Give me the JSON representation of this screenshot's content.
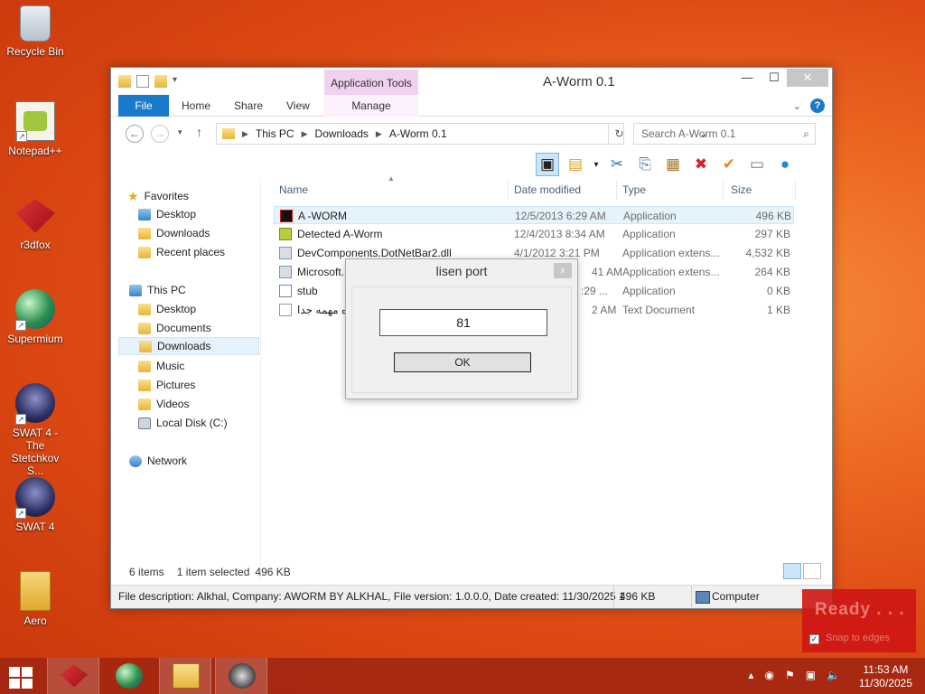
{
  "desktop": {
    "icons": [
      {
        "label": "Recycle Bin",
        "icon": "recycle-bin-icon",
        "shortcut": false
      },
      {
        "label": "Notepad++",
        "icon": "notepad-plus-plus-icon",
        "shortcut": true
      },
      {
        "label": "r3dfox",
        "icon": "r3dfox-icon",
        "shortcut": true
      },
      {
        "label": "Supermium",
        "icon": "supermium-icon",
        "shortcut": true
      },
      {
        "label": "SWAT 4 - The Stetchkov S...",
        "icon": "swat4-expansion-icon",
        "shortcut": true
      },
      {
        "label": "SWAT 4",
        "icon": "swat4-icon",
        "shortcut": true
      },
      {
        "label": "Aero",
        "icon": "folder-icon",
        "shortcut": false
      }
    ]
  },
  "window": {
    "title": "A-Worm 0.1",
    "context_tab": "Application Tools",
    "ribbon_tabs": {
      "file": "File",
      "home": "Home",
      "share": "Share",
      "view": "View",
      "manage": "Manage"
    },
    "address": {
      "parts": [
        "This PC",
        "Downloads",
        "A-Worm 0.1"
      ]
    },
    "search_placeholder": "Search A-Worm 0.1",
    "nav": {
      "favorites": "Favorites",
      "fav_items": [
        "Desktop",
        "Downloads",
        "Recent places"
      ],
      "thispc": "This PC",
      "pc_items": [
        "Desktop",
        "Documents",
        "Downloads",
        "Music",
        "Pictures",
        "Videos",
        "Local Disk (C:)"
      ],
      "network": "Network"
    },
    "columns": {
      "name": "Name",
      "date": "Date modified",
      "type": "Type",
      "size": "Size"
    },
    "files": [
      {
        "name": "A -WORM",
        "date": "12/5/2013 6:29 AM",
        "type": "Application",
        "size": "496 KB",
        "icon": "a-worm-app-icon"
      },
      {
        "name": "Detected A-Worm",
        "date": "12/4/2013 8:34 AM",
        "type": "Application",
        "size": "297 KB",
        "icon": "detected-app-icon"
      },
      {
        "name": "DevComponents.DotNetBar2.dll",
        "date": "4/1/2012 3:21 PM",
        "type": "Application extens...",
        "size": "4,532 KB",
        "icon": "dll-icon"
      },
      {
        "name": "Microsoft.",
        "date": "41 AM",
        "type": "Application extens...",
        "size": "264 KB",
        "icon": "dll-icon"
      },
      {
        "name": "stub",
        "date": ":29 ...",
        "type": "Application",
        "size": "0 KB",
        "icon": "app-icon"
      },
      {
        "name": "ه مهمه جدا",
        "date": "2 AM",
        "type": "Text Document",
        "size": "1 KB",
        "icon": "text-file-icon"
      }
    ],
    "status": {
      "count": "6 items",
      "selected": "1 item selected",
      "sel_size": "496 KB"
    },
    "details_bar": {
      "description": "File description: Alkhal, Company: AWORM BY ALKHAL, File version: 1.0.0.0, Date created: 11/30/2025 1",
      "size": "496 KB",
      "location": "Computer"
    }
  },
  "dialog": {
    "title": "lisen port",
    "close": "x",
    "value": "81",
    "ok": "OK"
  },
  "overlay": {
    "ready": "Ready . . .",
    "snap": "Snap to edges",
    "snap_check": "✓"
  },
  "taskbar": {
    "time": "11:53 AM",
    "date": "11/30/2025",
    "running": [
      "r3dfox-taskbar-icon",
      "supermium-taskbar-icon",
      "file-explorer-taskbar-icon",
      "network-tool-taskbar-icon"
    ]
  },
  "colors": {
    "accent": "#1979ca",
    "context_tab": "#f1d1f0",
    "overlay": "#cd1614"
  }
}
